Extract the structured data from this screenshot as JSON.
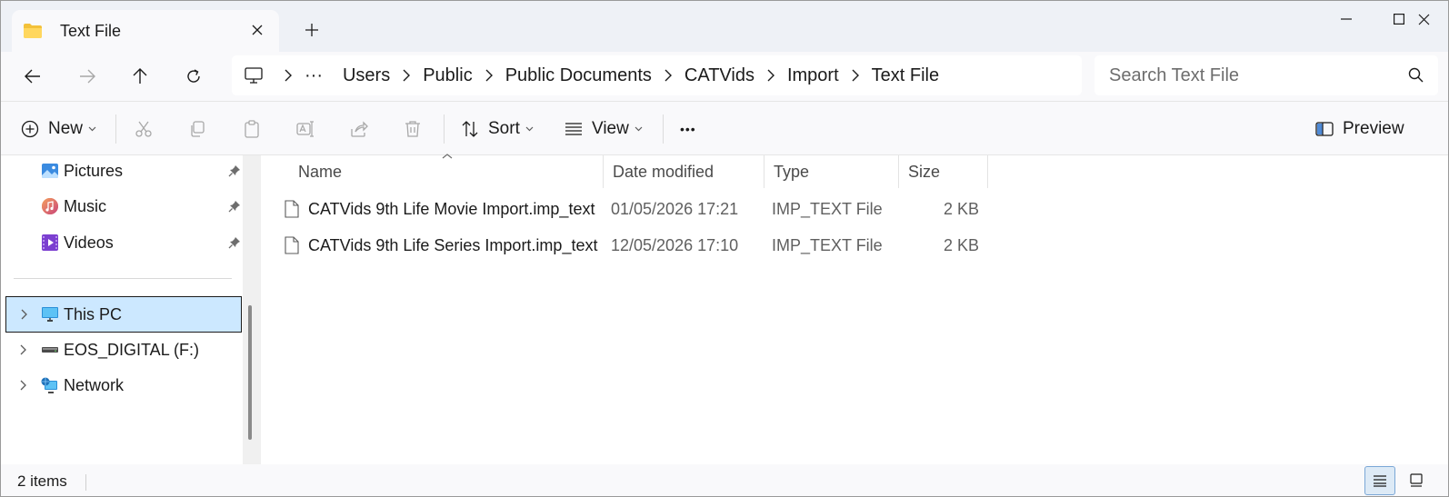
{
  "window": {
    "tab_title": "Text File"
  },
  "address": {
    "ellipsis": "···",
    "breadcrumbs": [
      "Users",
      "Public",
      "Public Documents",
      "CATVids",
      "Import",
      "Text File"
    ],
    "search_placeholder": "Search Text File"
  },
  "commandbar": {
    "new_label": "New",
    "sort_label": "Sort",
    "view_label": "View",
    "more_label": "•••",
    "preview_label": "Preview"
  },
  "navpane": {
    "quick_access": [
      {
        "label": "Pictures",
        "icon": "pictures-icon"
      },
      {
        "label": "Music",
        "icon": "music-icon"
      },
      {
        "label": "Videos",
        "icon": "videos-icon"
      }
    ],
    "tree": [
      {
        "label": "This PC",
        "icon": "computer-icon",
        "selected": true
      },
      {
        "label": "EOS_DIGITAL (F:)",
        "icon": "drive-icon",
        "selected": false
      },
      {
        "label": "Network",
        "icon": "network-icon",
        "selected": false
      }
    ]
  },
  "filelist": {
    "columns": [
      "Name",
      "Date modified",
      "Type",
      "Size"
    ],
    "rows": [
      {
        "name": "CATVids 9th Life Movie Import.imp_text",
        "date": "01/05/2026 17:21",
        "type": "IMP_TEXT File",
        "size": "2 KB"
      },
      {
        "name": "CATVids 9th Life Series Import.imp_text",
        "date": "12/05/2026 17:10",
        "type": "IMP_TEXT File",
        "size": "2 KB"
      }
    ]
  },
  "status": {
    "item_count": "2 items"
  },
  "colors": {
    "selection_bg": "#cce8ff",
    "titlebar_bg": "#eef1f6",
    "folder_yellow": "#f3c13a"
  }
}
